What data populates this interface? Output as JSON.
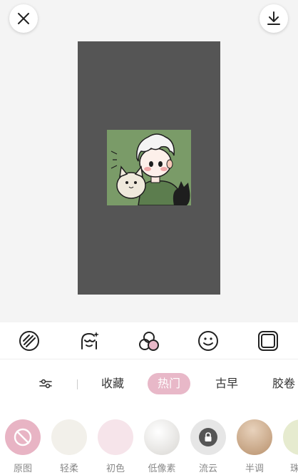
{
  "header": {
    "close_icon": "close-icon",
    "download_icon": "download-icon"
  },
  "preview": {
    "canvas_color": "#555555",
    "photo_bg_color": "#7a9b68"
  },
  "toolbar": {
    "tools": [
      {
        "name": "magic-wand-icon"
      },
      {
        "name": "face-sparkle-icon"
      },
      {
        "name": "filter-circles-icon"
      },
      {
        "name": "smiley-icon"
      },
      {
        "name": "frame-icon"
      }
    ]
  },
  "tabs": {
    "adjust_icon": "sliders-icon",
    "items": [
      {
        "label": "收藏"
      },
      {
        "label": "热门",
        "active": true
      },
      {
        "label": "古早"
      },
      {
        "label": "胶卷"
      }
    ],
    "accent_color": "#e8b8c8"
  },
  "filters": [
    {
      "label": "原图",
      "color": "#e8b4c4",
      "icon": "no-filter-icon"
    },
    {
      "label": "轻柔",
      "color": "#f2f0ea"
    },
    {
      "label": "初色",
      "color": "#f6e4ea"
    },
    {
      "label": "低像素",
      "color": "#e6e4e0"
    },
    {
      "label": "流云",
      "color": "#e6e6e6",
      "icon": "lock-icon"
    },
    {
      "label": "半调",
      "color": "#c9a98a"
    },
    {
      "label": "珠",
      "color": "#e6ebcf"
    }
  ]
}
